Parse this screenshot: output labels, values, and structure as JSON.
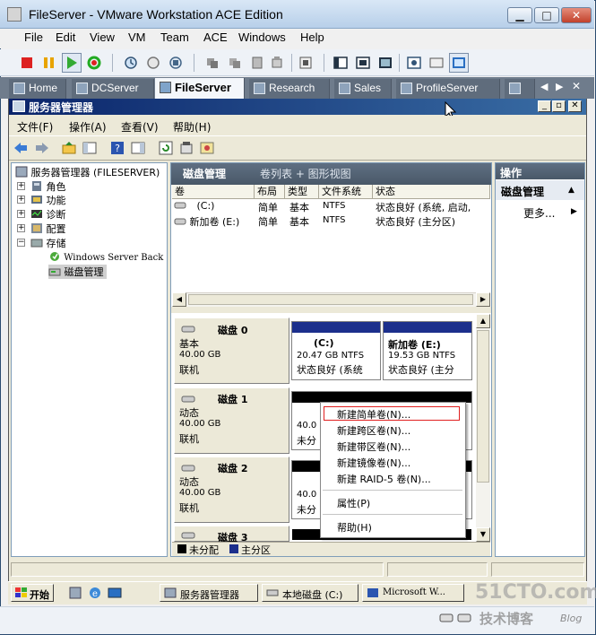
{
  "vmware": {
    "title": "FileServer - VMware Workstation ACE Edition",
    "window_buttons": {
      "minimize": "▁",
      "maximize": "□",
      "close": "✕"
    },
    "menu": [
      "File",
      "Edit",
      "View",
      "VM",
      "Team",
      "ACE",
      "Windows",
      "Help"
    ],
    "tabs": [
      {
        "label": "Home",
        "active": false
      },
      {
        "label": "DCServer",
        "active": false
      },
      {
        "label": "FileServer",
        "active": true
      },
      {
        "label": "Research",
        "active": false
      },
      {
        "label": "Sales",
        "active": false
      },
      {
        "label": "ProfileServer",
        "active": false
      }
    ],
    "tab_nav": {
      "left": "◀",
      "right": "▶",
      "close": "✕"
    }
  },
  "server_manager": {
    "title": "服务器管理器",
    "window_buttons": {
      "minimize": "_",
      "restore": "▫",
      "close": "✕"
    },
    "menu": [
      "文件(F)",
      "操作(A)",
      "查看(V)",
      "帮助(H)"
    ],
    "tree": {
      "root": "服务器管理器 (FILESERVER)",
      "items": [
        {
          "label": "角色",
          "expander": "+"
        },
        {
          "label": "功能",
          "expander": "+"
        },
        {
          "label": "诊断",
          "expander": "+"
        },
        {
          "label": "配置",
          "expander": "+"
        },
        {
          "label": "存储",
          "expander": "−"
        }
      ],
      "children": [
        "Windows Server Back",
        "磁盘管理"
      ]
    },
    "center": {
      "title": "磁盘管理",
      "subtitle": "卷列表 + 图形视图",
      "columns": [
        "卷",
        "布局",
        "类型",
        "文件系统",
        "状态"
      ],
      "volumes": [
        {
          "name": "(C:)",
          "layout": "简单",
          "type": "基本",
          "fs": "NTFS",
          "status": "状态良好 (系统, 启动,"
        },
        {
          "name": "新加卷 (E:)",
          "layout": "简单",
          "type": "基本",
          "fs": "NTFS",
          "status": "状态良好 (主分区)"
        }
      ],
      "disks": [
        {
          "name": "磁盘 0",
          "kind": "基本",
          "size": "40.00 GB",
          "state": "联机",
          "partitions": [
            {
              "title": "(C:)",
              "size": "20.47 GB NTFS",
              "status": "状态良好 (系统"
            },
            {
              "title": "新加卷  (E:)",
              "size": "19.53 GB NTFS",
              "status": "状态良好 (主分"
            }
          ]
        },
        {
          "name": "磁盘 1",
          "kind": "动态",
          "size": "40.00 GB",
          "state": "联机",
          "un_size": "40.0",
          "un_label": "未分"
        },
        {
          "name": "磁盘 2",
          "kind": "动态",
          "size": "40.00 GB",
          "state": "联机",
          "un_size": "40.0",
          "un_label": "未分"
        },
        {
          "name": "磁盘 3"
        }
      ],
      "legend": [
        "未分配",
        "主分区"
      ]
    },
    "context_menu": {
      "items": [
        "新建简单卷(N)...",
        "新建跨区卷(N)...",
        "新建带区卷(N)...",
        "新建镜像卷(N)...",
        "新建 RAID-5 卷(N)...",
        "属性(P)",
        "帮助(H)"
      ]
    },
    "actions": {
      "header": "操作",
      "section": "磁盘管理",
      "more": "更多..."
    }
  },
  "taskbar": {
    "start": "开始",
    "tasks": [
      "服务器管理器",
      "本地磁盘 (C:)",
      "Microsoft W..."
    ]
  },
  "watermark": {
    "site": "51CTO.com",
    "sub": "技术博客",
    "blog": "Blog"
  },
  "colors": {
    "sm_title": "#0a246a",
    "primary_partition": "#1c2f8c",
    "unallocated": "#000000",
    "context_highlight": "#e02020"
  }
}
